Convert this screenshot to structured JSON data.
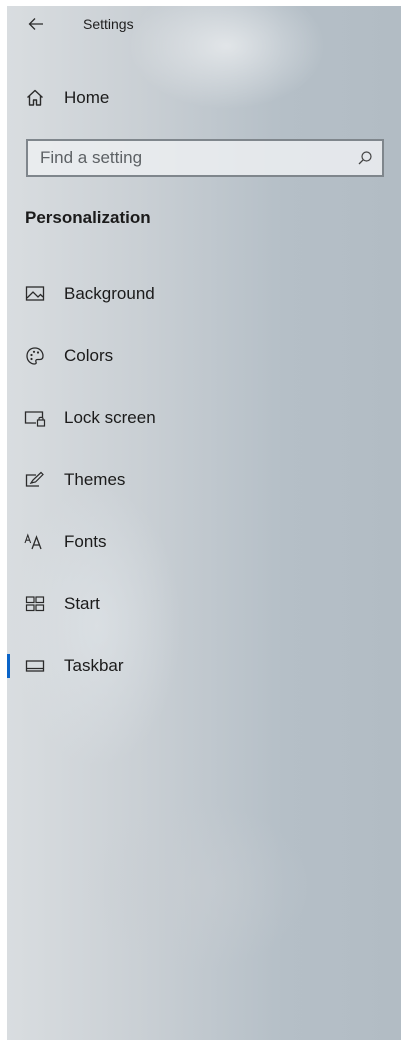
{
  "window": {
    "title": "Settings"
  },
  "nav": {
    "home_label": "Home"
  },
  "search": {
    "placeholder": "Find a setting",
    "value": ""
  },
  "section": {
    "heading": "Personalization"
  },
  "menu": {
    "items": [
      {
        "label": "Background",
        "icon": "picture-icon"
      },
      {
        "label": "Colors",
        "icon": "palette-icon"
      },
      {
        "label": "Lock screen",
        "icon": "lock-screen-icon"
      },
      {
        "label": "Themes",
        "icon": "themes-icon"
      },
      {
        "label": "Fonts",
        "icon": "fonts-icon"
      },
      {
        "label": "Start",
        "icon": "start-icon"
      },
      {
        "label": "Taskbar",
        "icon": "taskbar-icon",
        "selected": true
      }
    ]
  },
  "colors": {
    "accent": "#0a64c8",
    "text": "#1b1b1b"
  }
}
